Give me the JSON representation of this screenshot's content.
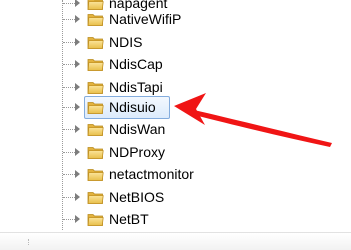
{
  "registry_tree": {
    "items": [
      {
        "label": "napagent",
        "icon": "folder-icon",
        "expander": "expand-arrow-icon"
      },
      {
        "label": "NativeWifiP",
        "icon": "folder-icon",
        "expander": "expand-arrow-icon"
      },
      {
        "label": "NDIS",
        "icon": "folder-icon",
        "expander": "expand-arrow-icon"
      },
      {
        "label": "NdisCap",
        "icon": "folder-icon",
        "expander": "expand-arrow-icon"
      },
      {
        "label": "NdisTapi",
        "icon": "folder-icon",
        "expander": "expand-arrow-icon"
      },
      {
        "label": "Ndisuio",
        "icon": "folder-icon",
        "expander": "expand-arrow-icon",
        "selected": true
      },
      {
        "label": "NdisWan",
        "icon": "folder-icon",
        "expander": "expand-arrow-icon"
      },
      {
        "label": "NDProxy",
        "icon": "folder-icon",
        "expander": "expand-arrow-icon"
      },
      {
        "label": "netactmonitor",
        "icon": "folder-icon",
        "expander": "expand-arrow-icon"
      },
      {
        "label": "NetBIOS",
        "icon": "folder-icon",
        "expander": "expand-arrow-icon"
      },
      {
        "label": "NetBT",
        "icon": "folder-icon",
        "expander": "expand-arrow-icon"
      }
    ]
  },
  "colors": {
    "selection_border": "#84acdd",
    "selection_fill": "#dcebfc",
    "folder_fill": "#f3d36c",
    "annotation_arrow": "#f01515"
  },
  "annotation": {
    "shape": "arrow",
    "target": "Ndisuio"
  }
}
